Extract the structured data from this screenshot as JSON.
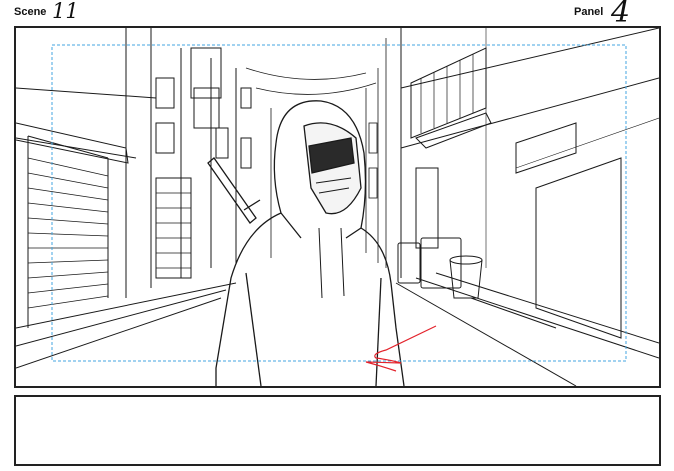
{
  "header": {
    "scene_label": "Scene",
    "scene_number": "11",
    "panel_label": "Panel",
    "panel_number": "4"
  },
  "colors": {
    "line_art": "#1a1a1a",
    "safe_area_guide": "#43a6e0",
    "annotation_stroke": "#e3232c"
  }
}
